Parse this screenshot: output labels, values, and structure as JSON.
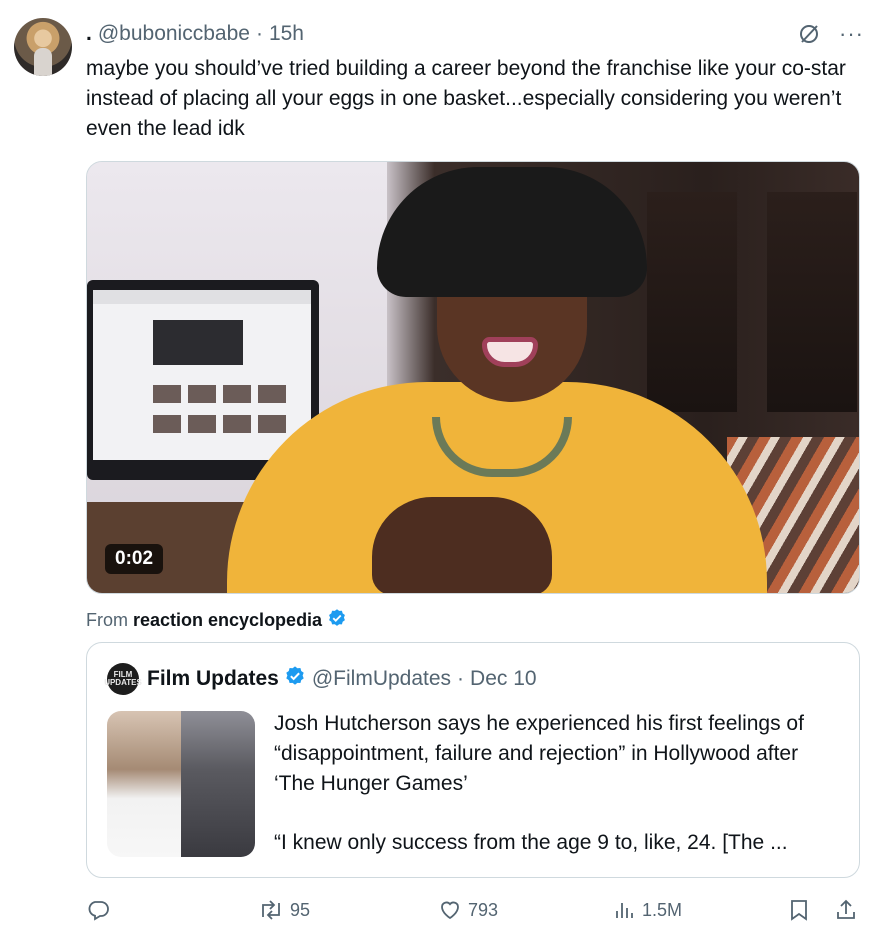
{
  "tweet": {
    "name_prefix": ".",
    "handle": "@buboniccbabe",
    "separator": "·",
    "time": "15h",
    "text": "maybe you should’ve tried building a career beyond the franchise like your co-star instead of placing all your eggs in one basket...especially considering you weren’t even the lead idk"
  },
  "media": {
    "timestamp": "0:02"
  },
  "from": {
    "prefix": "From",
    "source": "reaction encyclopedia"
  },
  "quote": {
    "avatar_text": "FILM UPDATES",
    "name": "Film Updates",
    "handle": "@FilmUpdates",
    "separator": "·",
    "date": "Dec 10",
    "text": "Josh Hutcherson says he experienced his first feelings of “disappointment, failure and rejection” in Hollywood after ‘The Hunger Games’",
    "text2": "“I knew only success from the age 9 to, like, 24. [The ..."
  },
  "actions": {
    "retweets": "95",
    "likes": "793",
    "views": "1.5M"
  },
  "colors": {
    "verified": "#1d9bf0",
    "muted": "#536471",
    "text": "#0f1419"
  },
  "icons": [
    "grok-icon",
    "more-icon",
    "verified-icon",
    "reply-icon",
    "retweet-icon",
    "like-icon",
    "views-icon",
    "bookmark-icon",
    "share-icon"
  ]
}
